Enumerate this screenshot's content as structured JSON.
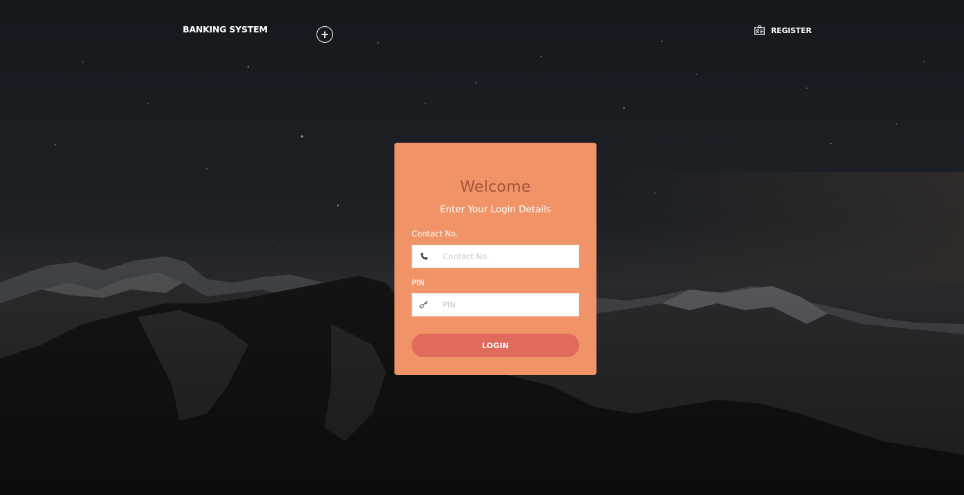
{
  "navbar": {
    "brand": "BANKING SYSTEM",
    "toggle_symbol": "+",
    "register_label": "REGISTER",
    "register_icon": "id-card-icon"
  },
  "login_card": {
    "title": "Welcome",
    "subtitle": "Enter Your Login Details",
    "contact_label": "Contact No.",
    "contact_placeholder": "Contact No.",
    "contact_value": "",
    "contact_icon": "phone-icon",
    "pin_label": "PIN",
    "pin_placeholder": "PIN",
    "pin_value": "",
    "pin_icon": "key-icon",
    "login_button": "LOGIN"
  },
  "colors": {
    "card_background": "#f09467",
    "title_color": "#a5533a",
    "button_color": "#e06a5c",
    "text_light": "#ffffff"
  },
  "background": {
    "image": "night-sky-over-snowy-mountains"
  }
}
